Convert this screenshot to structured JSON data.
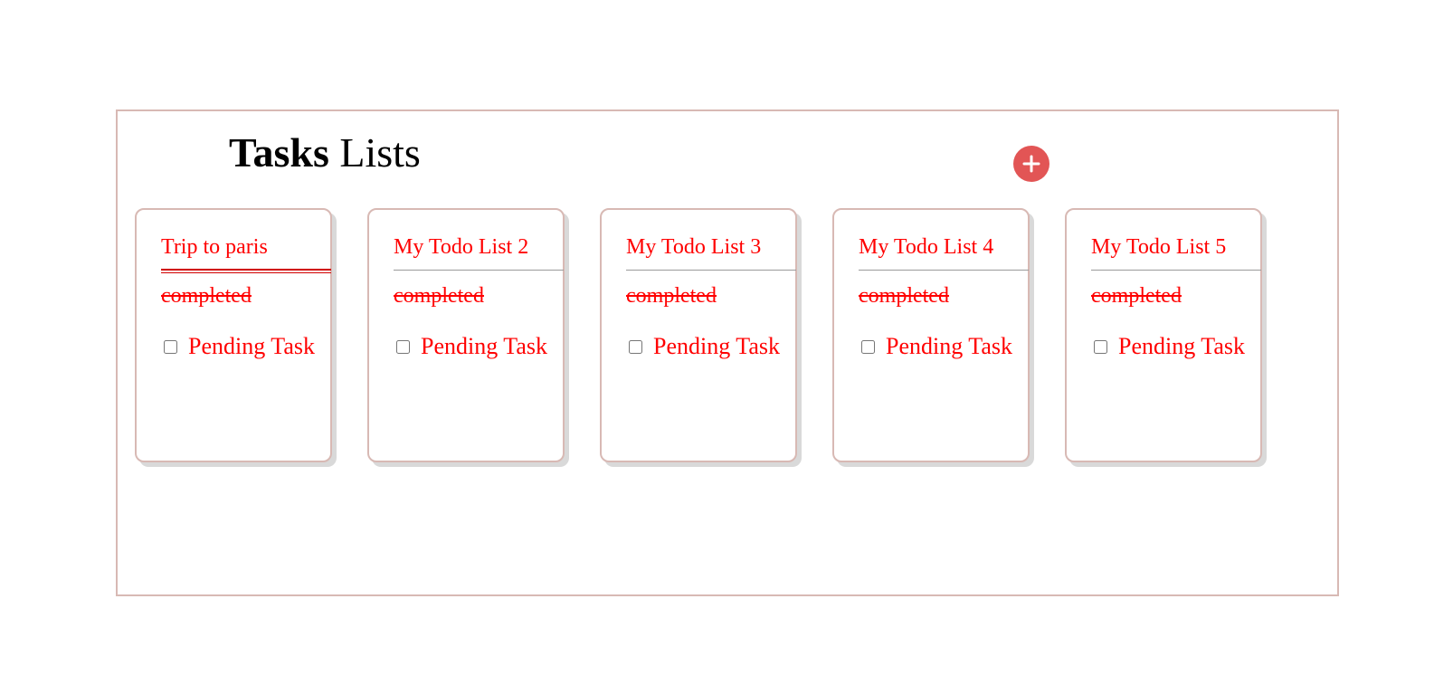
{
  "header": {
    "title_bold": "Tasks",
    "title_rest": " Lists",
    "add_icon": "plus-icon",
    "accent_color": "#e25555"
  },
  "lists": [
    {
      "title": "Trip to paris",
      "completed_label": "completed",
      "task_label": "Pending Task",
      "task_checked": false
    },
    {
      "title": "My Todo List 2",
      "completed_label": "completed",
      "task_label": "Pending Task",
      "task_checked": false
    },
    {
      "title": "My Todo List 3",
      "completed_label": "completed",
      "task_label": "Pending Task",
      "task_checked": false
    },
    {
      "title": "My Todo List 4",
      "completed_label": "completed",
      "task_label": "Pending Task",
      "task_checked": false
    },
    {
      "title": "My Todo List 5",
      "completed_label": "completed",
      "task_label": "Pending Task",
      "task_checked": false
    }
  ]
}
